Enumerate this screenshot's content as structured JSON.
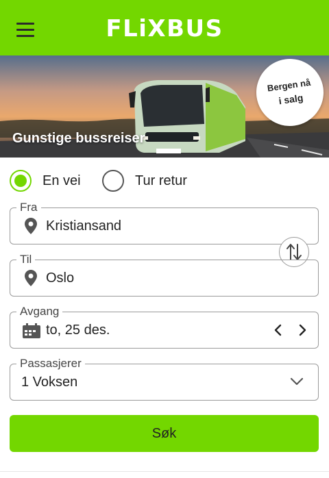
{
  "header": {
    "logo_text": "FLiXBUS",
    "menu_icon": "hamburger-menu-icon",
    "brand_color": "#73d700"
  },
  "hero": {
    "caption": "Gunstige bussreiser",
    "badge_line1": "Bergen nå",
    "badge_line2": "i salg"
  },
  "trip_type": {
    "one_way": "En vei",
    "round_trip": "Tur retur",
    "selected": "En vei"
  },
  "form": {
    "from_label": "Fra",
    "from_value": "Kristiansand",
    "to_label": "Til",
    "to_value": "Oslo",
    "departure_label": "Avgang",
    "departure_value": "to, 25 des.",
    "passengers_label": "Passasjerer",
    "passengers_value": "1 Voksen"
  },
  "search_button": "Søk"
}
